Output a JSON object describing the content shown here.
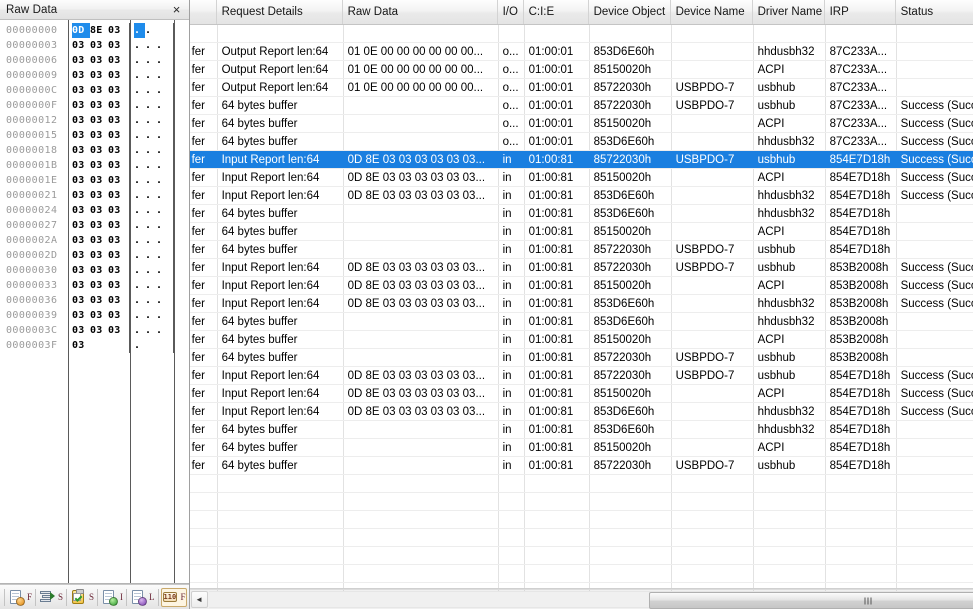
{
  "raw_data_panel": {
    "title": "Raw Data",
    "close_label": "×",
    "hex_rows": [
      {
        "offset": "00000000",
        "bytes": [
          "0D",
          "8E",
          "03"
        ],
        "ascii": [
          ".",
          "."
        ],
        "selected_byte_index": 0,
        "selected_ascii_index": 0
      },
      {
        "offset": "00000003",
        "bytes": [
          "03",
          "03",
          "03"
        ],
        "ascii": [
          ".",
          ".",
          "."
        ]
      },
      {
        "offset": "00000006",
        "bytes": [
          "03",
          "03",
          "03"
        ],
        "ascii": [
          ".",
          ".",
          "."
        ]
      },
      {
        "offset": "00000009",
        "bytes": [
          "03",
          "03",
          "03"
        ],
        "ascii": [
          ".",
          ".",
          "."
        ]
      },
      {
        "offset": "0000000C",
        "bytes": [
          "03",
          "03",
          "03"
        ],
        "ascii": [
          ".",
          ".",
          "."
        ]
      },
      {
        "offset": "0000000F",
        "bytes": [
          "03",
          "03",
          "03"
        ],
        "ascii": [
          ".",
          ".",
          "."
        ]
      },
      {
        "offset": "00000012",
        "bytes": [
          "03",
          "03",
          "03"
        ],
        "ascii": [
          ".",
          ".",
          "."
        ]
      },
      {
        "offset": "00000015",
        "bytes": [
          "03",
          "03",
          "03"
        ],
        "ascii": [
          ".",
          ".",
          "."
        ]
      },
      {
        "offset": "00000018",
        "bytes": [
          "03",
          "03",
          "03"
        ],
        "ascii": [
          ".",
          ".",
          "."
        ]
      },
      {
        "offset": "0000001B",
        "bytes": [
          "03",
          "03",
          "03"
        ],
        "ascii": [
          ".",
          ".",
          "."
        ]
      },
      {
        "offset": "0000001E",
        "bytes": [
          "03",
          "03",
          "03"
        ],
        "ascii": [
          ".",
          ".",
          "."
        ]
      },
      {
        "offset": "00000021",
        "bytes": [
          "03",
          "03",
          "03"
        ],
        "ascii": [
          ".",
          ".",
          "."
        ]
      },
      {
        "offset": "00000024",
        "bytes": [
          "03",
          "03",
          "03"
        ],
        "ascii": [
          ".",
          ".",
          "."
        ]
      },
      {
        "offset": "00000027",
        "bytes": [
          "03",
          "03",
          "03"
        ],
        "ascii": [
          ".",
          ".",
          "."
        ]
      },
      {
        "offset": "0000002A",
        "bytes": [
          "03",
          "03",
          "03"
        ],
        "ascii": [
          ".",
          ".",
          "."
        ]
      },
      {
        "offset": "0000002D",
        "bytes": [
          "03",
          "03",
          "03"
        ],
        "ascii": [
          ".",
          ".",
          "."
        ]
      },
      {
        "offset": "00000030",
        "bytes": [
          "03",
          "03",
          "03"
        ],
        "ascii": [
          ".",
          ".",
          "."
        ]
      },
      {
        "offset": "00000033",
        "bytes": [
          "03",
          "03",
          "03"
        ],
        "ascii": [
          ".",
          ".",
          "."
        ]
      },
      {
        "offset": "00000036",
        "bytes": [
          "03",
          "03",
          "03"
        ],
        "ascii": [
          ".",
          ".",
          "."
        ]
      },
      {
        "offset": "00000039",
        "bytes": [
          "03",
          "03",
          "03"
        ],
        "ascii": [
          ".",
          ".",
          "."
        ]
      },
      {
        "offset": "0000003C",
        "bytes": [
          "03",
          "03",
          "03"
        ],
        "ascii": [
          ".",
          ".",
          "."
        ]
      },
      {
        "offset": "0000003F",
        "bytes": [
          "03"
        ],
        "ascii": [
          "."
        ]
      }
    ],
    "toolbar": [
      {
        "icon": "export-file-icon",
        "label": "F",
        "active": false
      },
      {
        "icon": "stack-send-icon",
        "label": "S",
        "active": false
      },
      {
        "icon": "clipboard-check-icon",
        "label": "S",
        "active": false
      },
      {
        "icon": "import-file-icon",
        "label": "I",
        "active": false
      },
      {
        "icon": "load-file-icon",
        "label": "L",
        "active": false
      },
      {
        "icon": "hex-view-icon",
        "label": "F",
        "active": true
      }
    ]
  },
  "table": {
    "columns": [
      {
        "key": "idx",
        "label": ""
      },
      {
        "key": "req",
        "label": "Request Details"
      },
      {
        "key": "raw",
        "label": "Raw Data"
      },
      {
        "key": "io",
        "label": "I/O"
      },
      {
        "key": "cie",
        "label": "C:I:E"
      },
      {
        "key": "devobj",
        "label": "Device Object"
      },
      {
        "key": "devnm",
        "label": "Device Name"
      },
      {
        "key": "drv",
        "label": "Driver Name"
      },
      {
        "key": "irp",
        "label": "IRP"
      },
      {
        "key": "status",
        "label": "Status"
      }
    ],
    "selected_row_index": 7,
    "rows": [
      {
        "idx": "",
        "req": "",
        "raw": "",
        "io": "",
        "cie": "",
        "devobj": "",
        "devnm": "",
        "drv": "",
        "irp": "",
        "status": ""
      },
      {
        "idx": "fer",
        "req": "Output Report len:64",
        "raw": "01 0E 00 00 00 00 00 00...",
        "io": "o...",
        "cie": "01:00:01",
        "devobj": "853D6E60h",
        "devnm": "",
        "drv": "hhdusbh32",
        "irp": "87C233A...",
        "status": ""
      },
      {
        "idx": "fer",
        "req": "Output Report len:64",
        "raw": "01 0E 00 00 00 00 00 00...",
        "io": "o...",
        "cie": "01:00:01",
        "devobj": "85150020h",
        "devnm": "",
        "drv": "ACPI",
        "irp": "87C233A...",
        "status": ""
      },
      {
        "idx": "fer",
        "req": "Output Report len:64",
        "raw": "01 0E 00 00 00 00 00 00...",
        "io": "o...",
        "cie": "01:00:01",
        "devobj": "85722030h",
        "devnm": "USBPDO-7",
        "drv": "usbhub",
        "irp": "87C233A...",
        "status": ""
      },
      {
        "idx": "fer",
        "req": "64 bytes buffer",
        "raw": "",
        "io": "o...",
        "cie": "01:00:01",
        "devobj": "85722030h",
        "devnm": "USBPDO-7",
        "drv": "usbhub",
        "irp": "87C233A...",
        "status": "Success (Success)"
      },
      {
        "idx": "fer",
        "req": "64 bytes buffer",
        "raw": "",
        "io": "o...",
        "cie": "01:00:01",
        "devobj": "85150020h",
        "devnm": "",
        "drv": "ACPI",
        "irp": "87C233A...",
        "status": "Success (Success)"
      },
      {
        "idx": "fer",
        "req": "64 bytes buffer",
        "raw": "",
        "io": "o...",
        "cie": "01:00:01",
        "devobj": "853D6E60h",
        "devnm": "",
        "drv": "hhdusbh32",
        "irp": "87C233A...",
        "status": "Success (Success)"
      },
      {
        "idx": "fer",
        "req": "Input Report len:64",
        "raw": "0D 8E 03 03 03 03 03 03...",
        "io": "in",
        "cie": "01:00:81",
        "devobj": "85722030h",
        "devnm": "USBPDO-7",
        "drv": "usbhub",
        "irp": "854E7D18h",
        "status": "Success (Success)"
      },
      {
        "idx": "fer",
        "req": "Input Report len:64",
        "raw": "0D 8E 03 03 03 03 03 03...",
        "io": "in",
        "cie": "01:00:81",
        "devobj": "85150020h",
        "devnm": "",
        "drv": "ACPI",
        "irp": "854E7D18h",
        "status": "Success (Success)"
      },
      {
        "idx": "fer",
        "req": "Input Report len:64",
        "raw": "0D 8E 03 03 03 03 03 03...",
        "io": "in",
        "cie": "01:00:81",
        "devobj": "853D6E60h",
        "devnm": "",
        "drv": "hhdusbh32",
        "irp": "854E7D18h",
        "status": "Success (Success)"
      },
      {
        "idx": "fer",
        "req": "64 bytes buffer",
        "raw": "",
        "io": "in",
        "cie": "01:00:81",
        "devobj": "853D6E60h",
        "devnm": "",
        "drv": "hhdusbh32",
        "irp": "854E7D18h",
        "status": ""
      },
      {
        "idx": "fer",
        "req": "64 bytes buffer",
        "raw": "",
        "io": "in",
        "cie": "01:00:81",
        "devobj": "85150020h",
        "devnm": "",
        "drv": "ACPI",
        "irp": "854E7D18h",
        "status": ""
      },
      {
        "idx": "fer",
        "req": "64 bytes buffer",
        "raw": "",
        "io": "in",
        "cie": "01:00:81",
        "devobj": "85722030h",
        "devnm": "USBPDO-7",
        "drv": "usbhub",
        "irp": "854E7D18h",
        "status": ""
      },
      {
        "idx": "fer",
        "req": "Input Report len:64",
        "raw": "0D 8E 03 03 03 03 03 03...",
        "io": "in",
        "cie": "01:00:81",
        "devobj": "85722030h",
        "devnm": "USBPDO-7",
        "drv": "usbhub",
        "irp": "853B2008h",
        "status": "Success (Success)"
      },
      {
        "idx": "fer",
        "req": "Input Report len:64",
        "raw": "0D 8E 03 03 03 03 03 03...",
        "io": "in",
        "cie": "01:00:81",
        "devobj": "85150020h",
        "devnm": "",
        "drv": "ACPI",
        "irp": "853B2008h",
        "status": "Success (Success)"
      },
      {
        "idx": "fer",
        "req": "Input Report len:64",
        "raw": "0D 8E 03 03 03 03 03 03...",
        "io": "in",
        "cie": "01:00:81",
        "devobj": "853D6E60h",
        "devnm": "",
        "drv": "hhdusbh32",
        "irp": "853B2008h",
        "status": "Success (Success)"
      },
      {
        "idx": "fer",
        "req": "64 bytes buffer",
        "raw": "",
        "io": "in",
        "cie": "01:00:81",
        "devobj": "853D6E60h",
        "devnm": "",
        "drv": "hhdusbh32",
        "irp": "853B2008h",
        "status": ""
      },
      {
        "idx": "fer",
        "req": "64 bytes buffer",
        "raw": "",
        "io": "in",
        "cie": "01:00:81",
        "devobj": "85150020h",
        "devnm": "",
        "drv": "ACPI",
        "irp": "853B2008h",
        "status": ""
      },
      {
        "idx": "fer",
        "req": "64 bytes buffer",
        "raw": "",
        "io": "in",
        "cie": "01:00:81",
        "devobj": "85722030h",
        "devnm": "USBPDO-7",
        "drv": "usbhub",
        "irp": "853B2008h",
        "status": ""
      },
      {
        "idx": "fer",
        "req": "Input Report len:64",
        "raw": "0D 8E 03 03 03 03 03 03...",
        "io": "in",
        "cie": "01:00:81",
        "devobj": "85722030h",
        "devnm": "USBPDO-7",
        "drv": "usbhub",
        "irp": "854E7D18h",
        "status": "Success (Success)"
      },
      {
        "idx": "fer",
        "req": "Input Report len:64",
        "raw": "0D 8E 03 03 03 03 03 03...",
        "io": "in",
        "cie": "01:00:81",
        "devobj": "85150020h",
        "devnm": "",
        "drv": "ACPI",
        "irp": "854E7D18h",
        "status": "Success (Success)"
      },
      {
        "idx": "fer",
        "req": "Input Report len:64",
        "raw": "0D 8E 03 03 03 03 03 03...",
        "io": "in",
        "cie": "01:00:81",
        "devobj": "853D6E60h",
        "devnm": "",
        "drv": "hhdusbh32",
        "irp": "854E7D18h",
        "status": "Success (Success)"
      },
      {
        "idx": "fer",
        "req": "64 bytes buffer",
        "raw": "",
        "io": "in",
        "cie": "01:00:81",
        "devobj": "853D6E60h",
        "devnm": "",
        "drv": "hhdusbh32",
        "irp": "854E7D18h",
        "status": ""
      },
      {
        "idx": "fer",
        "req": "64 bytes buffer",
        "raw": "",
        "io": "in",
        "cie": "01:00:81",
        "devobj": "85150020h",
        "devnm": "",
        "drv": "ACPI",
        "irp": "854E7D18h",
        "status": ""
      },
      {
        "idx": "fer",
        "req": "64 bytes buffer",
        "raw": "",
        "io": "in",
        "cie": "01:00:81",
        "devobj": "85722030h",
        "devnm": "USBPDO-7",
        "drv": "usbhub",
        "irp": "854E7D18h",
        "status": ""
      }
    ]
  },
  "hscrollbar": {
    "left_arrow": "◄",
    "right_arrow": "►"
  },
  "colors": {
    "selection_blue": "#1a7fe0",
    "hex_selection_blue": "#1f8ceb",
    "header_text": "#151515",
    "offset_gray": "#9a9a9a"
  }
}
